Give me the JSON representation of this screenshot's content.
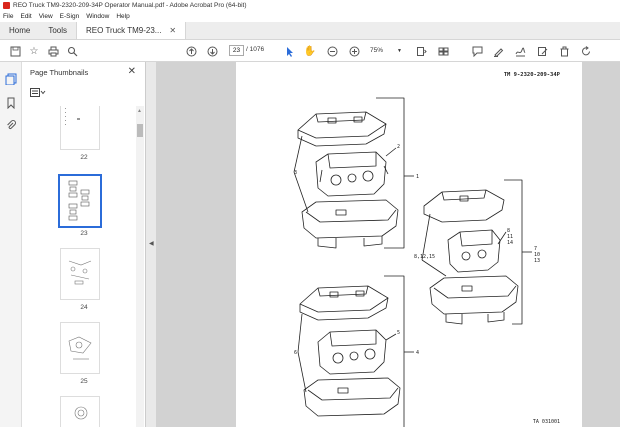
{
  "window": {
    "title": "REO Truck TM9-2320-209-34P Operator Manual.pdf - Adobe Acrobat Pro (64-bit)"
  },
  "menu": {
    "items": [
      "File",
      "Edit",
      "View",
      "E-Sign",
      "Window",
      "Help"
    ]
  },
  "tabs": {
    "home": "Home",
    "tools": "Tools",
    "document": "REO Truck TM9-23..."
  },
  "toolbar": {
    "current_page": "23",
    "page_total": "/ 1076",
    "zoom": "75%"
  },
  "panel": {
    "title": "Page Thumbnails",
    "thumbnails": [
      {
        "label": "22",
        "selected": false
      },
      {
        "label": "23",
        "selected": true
      },
      {
        "label": "24",
        "selected": false
      },
      {
        "label": "25",
        "selected": false
      }
    ]
  },
  "document": {
    "header": "TM 9-2320-209-34P",
    "footer": "TA 031001",
    "callouts": [
      "1",
      "2",
      "3",
      "4",
      "5",
      "6",
      "7",
      "8",
      "9",
      "10",
      "11",
      "12",
      "13",
      "14",
      "8,12,15"
    ]
  }
}
